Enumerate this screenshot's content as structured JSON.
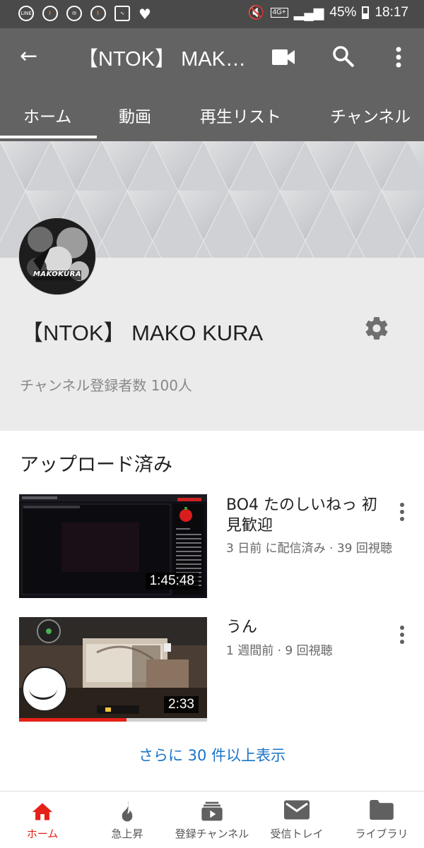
{
  "status_bar": {
    "left_icons": [
      "line-icon",
      "walk-icon",
      "mail-icon",
      "walk-icon",
      "activity-icon",
      "heart-icon"
    ],
    "line_label": "LINE",
    "network_badge": "4G+",
    "battery": "45%",
    "time": "18:17"
  },
  "app_bar": {
    "title": "【NTOK】 MAKO KURA",
    "tabs": [
      {
        "label": "ホーム",
        "active": true
      },
      {
        "label": "動画"
      },
      {
        "label": "再生リスト"
      },
      {
        "label": "チャンネル"
      }
    ]
  },
  "channel": {
    "avatar_text": "MAKOKURA",
    "name": "【NTOK】 MAKO KURA",
    "subscribers": "チャンネル登録者数 100人"
  },
  "uploads": {
    "section_title": "アップロード済み",
    "videos": [
      {
        "title": "BO4 たのしいねっ 初見歓迎",
        "meta": "3 日前 に配信済み · 39 回視聴",
        "duration": "1:45:48",
        "progress": 0
      },
      {
        "title": "うん",
        "meta": "1 週間前 · 9 回視聴",
        "duration": "2:33",
        "progress": 0.57
      }
    ],
    "show_more": "さらに 30 件以上表示"
  },
  "bottom_nav": [
    {
      "label": "ホーム",
      "icon": "home-icon",
      "active": true
    },
    {
      "label": "急上昇",
      "icon": "trending-icon"
    },
    {
      "label": "登録チャンネル",
      "icon": "subscriptions-icon"
    },
    {
      "label": "受信トレイ",
      "icon": "inbox-icon"
    },
    {
      "label": "ライブラリ",
      "icon": "library-icon"
    }
  ],
  "colors": {
    "accent": "#e62117",
    "link": "#1a73c8",
    "app_bar": "#636363"
  }
}
